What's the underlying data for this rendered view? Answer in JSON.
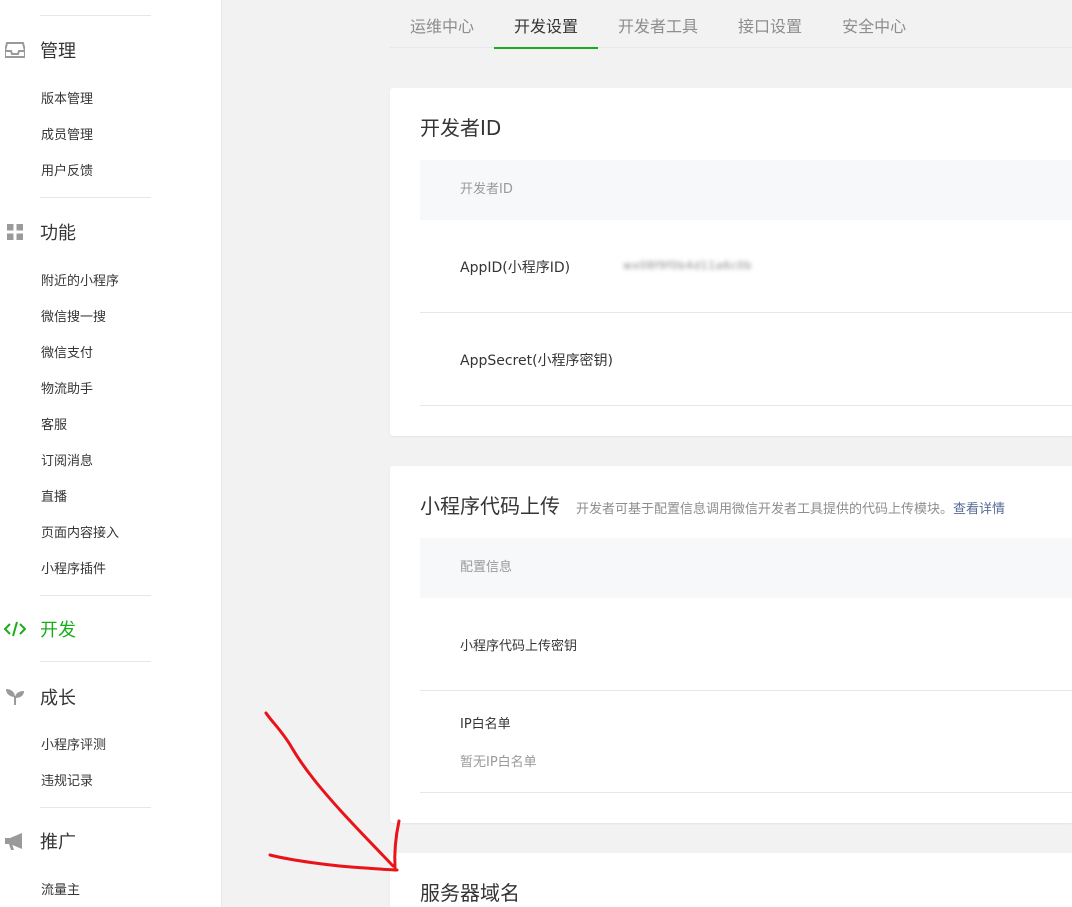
{
  "sidebar": {
    "groups": [
      {
        "label": "管理",
        "icon": "inbox-icon",
        "items": [
          "版本管理",
          "成员管理",
          "用户反馈"
        ]
      },
      {
        "label": "功能",
        "icon": "grid-icon",
        "items": [
          "附近的小程序",
          "微信搜一搜",
          "微信支付",
          "物流助手",
          "客服",
          "订阅消息",
          "直播",
          "页面内容接入",
          "小程序插件"
        ]
      },
      {
        "label": "开发",
        "icon": "code-icon",
        "items": []
      },
      {
        "label": "成长",
        "icon": "sprout-icon",
        "items": [
          "小程序评测",
          "违规记录"
        ]
      },
      {
        "label": "推广",
        "icon": "megaphone-icon",
        "items": [
          "流量主"
        ]
      }
    ]
  },
  "tabs": [
    "运维中心",
    "开发设置",
    "开发者工具",
    "接口设置",
    "安全中心"
  ],
  "active_tab": "开发设置",
  "developer_id": {
    "title": "开发者ID",
    "header": "开发者ID",
    "appid_label": "AppID(小程序ID)",
    "appid_value": "wx08f9f0b4d11a6c0b",
    "appsecret_label": "AppSecret(小程序密钥)"
  },
  "code_upload": {
    "title": "小程序代码上传",
    "desc": "开发者可基于配置信息调用微信开发者工具提供的代码上传模块。",
    "link": "查看详情",
    "header": "配置信息",
    "key_label": "小程序代码上传密钥",
    "ip_label": "IP白名单",
    "ip_empty": "暂无IP白名单"
  },
  "server_domain": {
    "title": "服务器域名"
  },
  "colors": {
    "accent": "#1aad19",
    "link": "#576b95",
    "annotation": "#e8141a"
  }
}
